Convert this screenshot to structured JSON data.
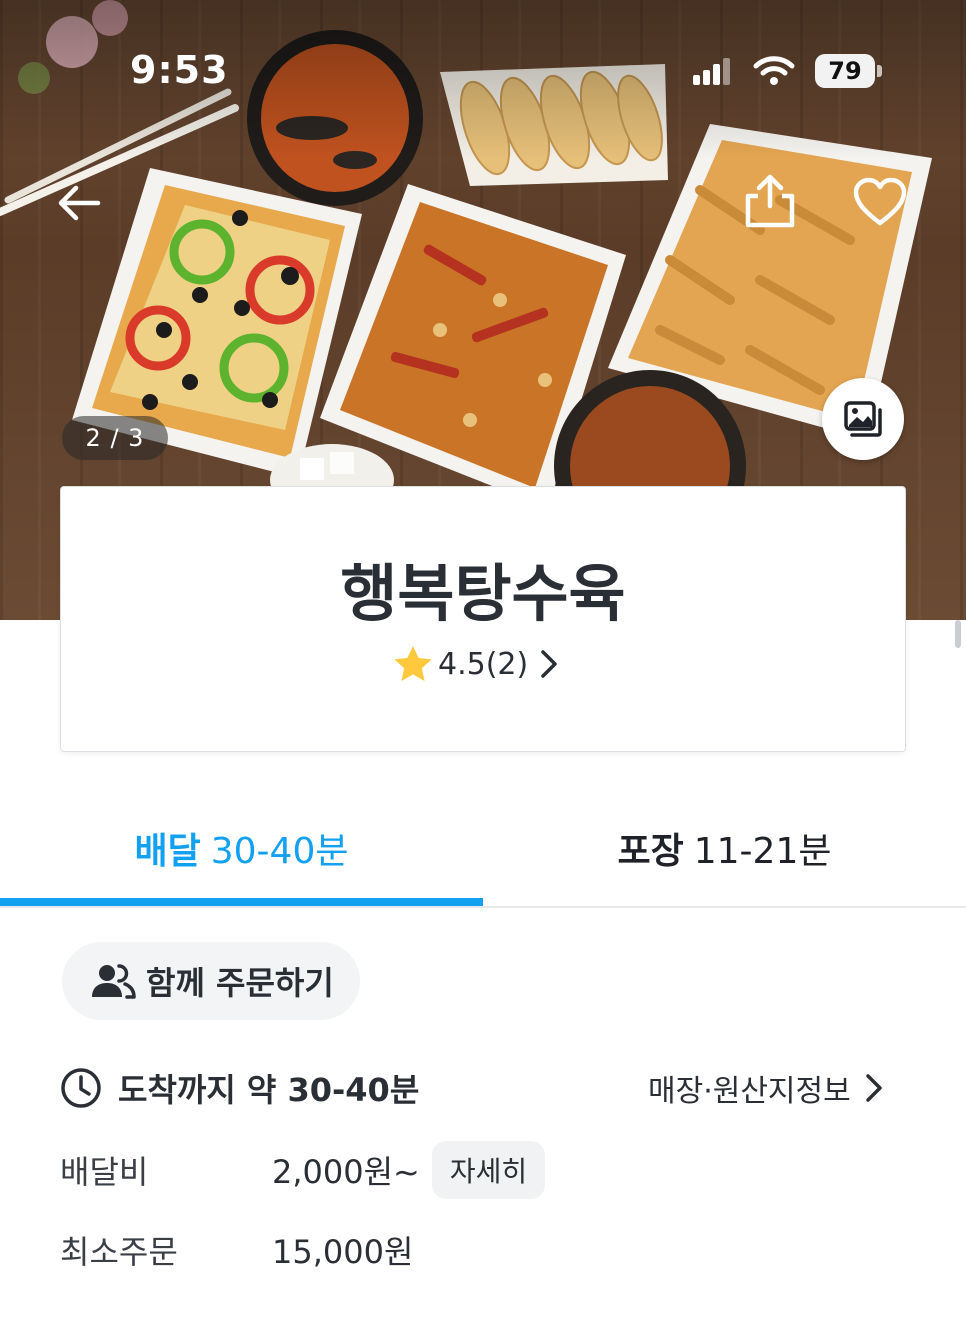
{
  "status_bar": {
    "time": "9:53",
    "battery": "79"
  },
  "hero": {
    "image_counter": "2 / 3"
  },
  "store": {
    "name": "행복탕수육",
    "rating": "4.5(2)"
  },
  "tabs": [
    {
      "label": "배달",
      "time": "30-40분",
      "active": true
    },
    {
      "label": "포장",
      "time": "11-21분",
      "active": false
    }
  ],
  "group_order": {
    "label": "함께 주문하기"
  },
  "eta": {
    "label": "도착까지 약 30-40분"
  },
  "store_info_link": {
    "label": "매장·원산지정보"
  },
  "info": {
    "delivery_fee_label": "배달비",
    "delivery_fee_value": "2,000원~",
    "detail_button": "자세히",
    "min_order_label": "최소주문",
    "min_order_value": "15,000원"
  },
  "colors": {
    "accent": "#12a0f0",
    "text": "#2a2f36",
    "star": "#ffc83d"
  },
  "icons": [
    "back-arrow-icon",
    "share-icon",
    "heart-icon",
    "gallery-icon",
    "star-icon",
    "chevron-right-icon",
    "people-icon",
    "clock-icon",
    "signal-icon",
    "wifi-icon"
  ]
}
